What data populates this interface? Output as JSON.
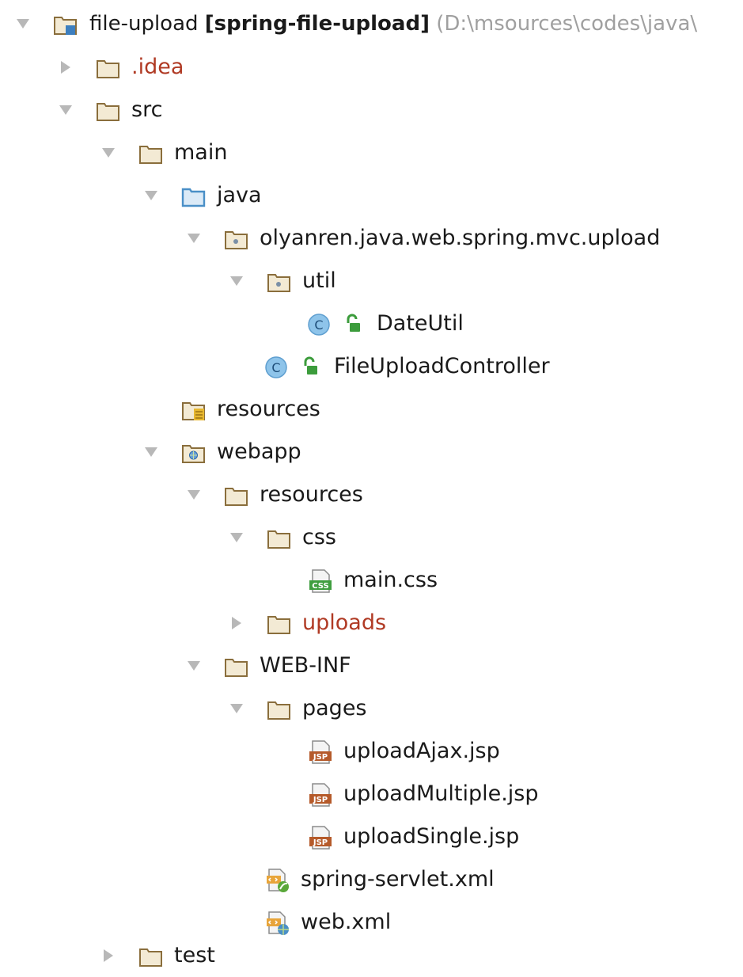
{
  "project_tree": {
    "root": {
      "name": "file-upload",
      "module": "[spring-file-upload]",
      "path": "(D:\\msources\\codes\\java\\"
    },
    "items": [
      {
        "label": ".idea",
        "icon": "folder-icon",
        "expanded": false
      },
      {
        "label": "src",
        "icon": "folder-icon",
        "expanded": true
      },
      {
        "label": "main",
        "icon": "folder-icon",
        "expanded": true
      },
      {
        "label": "java",
        "icon": "source-folder-icon",
        "expanded": true
      },
      {
        "label": "olyanren.java.web.spring.mvc.upload",
        "icon": "package-icon",
        "expanded": true
      },
      {
        "label": "util",
        "icon": "package-icon",
        "expanded": true
      },
      {
        "label": "DateUtil",
        "icon": "java-class-icon"
      },
      {
        "label": "FileUploadController",
        "icon": "java-class-icon"
      },
      {
        "label": "resources",
        "icon": "resources-folder-icon"
      },
      {
        "label": "webapp",
        "icon": "web-folder-icon",
        "expanded": true
      },
      {
        "label": "resources",
        "icon": "folder-icon",
        "expanded": true
      },
      {
        "label": "css",
        "icon": "folder-icon",
        "expanded": true
      },
      {
        "label": "main.css",
        "icon": "css-file-icon"
      },
      {
        "label": "uploads",
        "icon": "folder-icon",
        "expanded": false
      },
      {
        "label": "WEB-INF",
        "icon": "folder-icon",
        "expanded": true
      },
      {
        "label": "pages",
        "icon": "folder-icon",
        "expanded": true
      },
      {
        "label": "uploadAjax.jsp",
        "icon": "jsp-file-icon"
      },
      {
        "label": "uploadMultiple.jsp",
        "icon": "jsp-file-icon"
      },
      {
        "label": "uploadSingle.jsp",
        "icon": "jsp-file-icon"
      },
      {
        "label": "spring-servlet.xml",
        "icon": "spring-xml-file-icon"
      },
      {
        "label": "web.xml",
        "icon": "web-xml-file-icon"
      },
      {
        "label": "test",
        "icon": "folder-icon",
        "expanded": false
      }
    ]
  },
  "colors": {
    "excluded_text": "#b03a24",
    "folder_stroke": "#8a6e3c",
    "source_folder": "#4a8fc7",
    "class_badge": "#8ec4ea",
    "lock_green": "#3c9c3c",
    "arrow": "#b8b8b8",
    "path_text": "#a0a0a0"
  }
}
